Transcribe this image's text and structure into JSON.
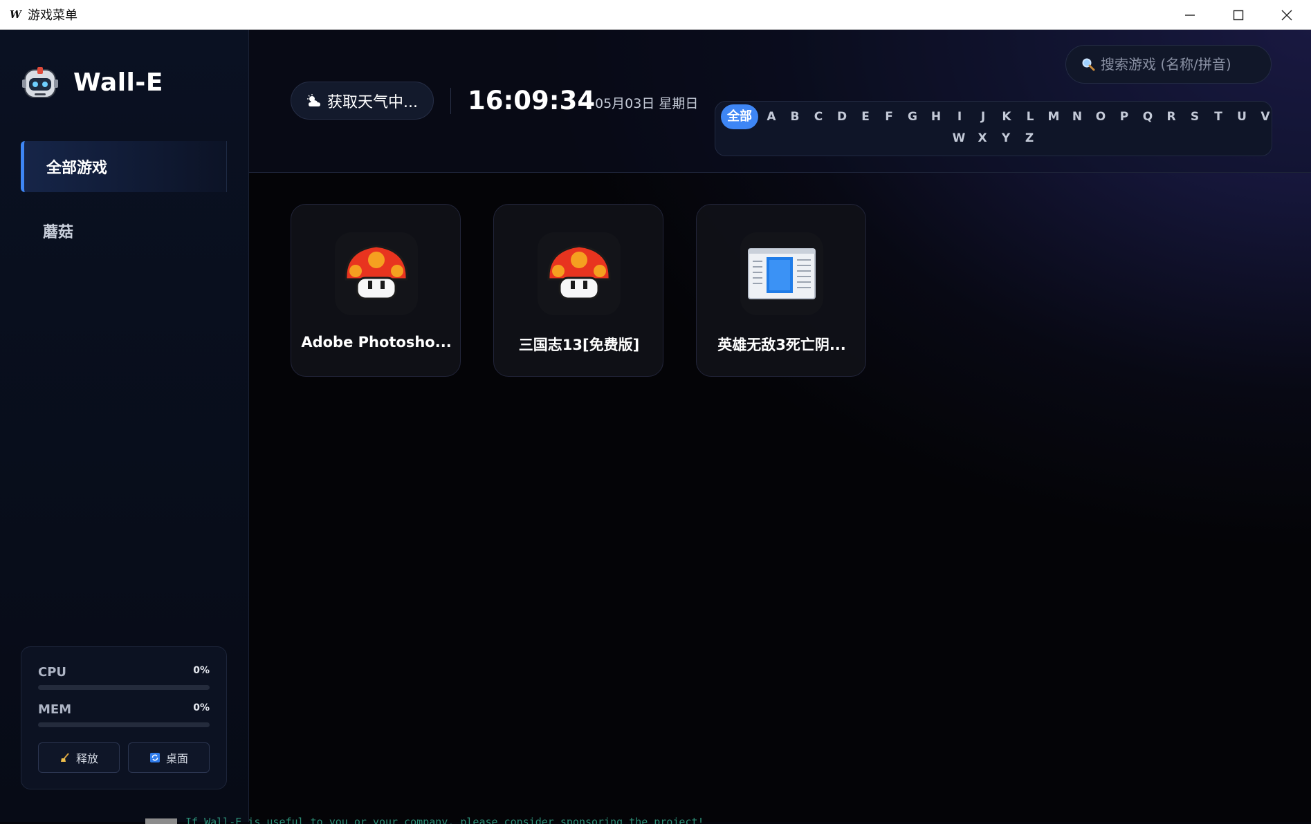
{
  "window": {
    "app_logo": "W",
    "title": "游戏菜单",
    "controls": [
      "minimize-icon",
      "maximize-icon",
      "close-icon"
    ]
  },
  "sidebar": {
    "brand": "Wall-E",
    "brand_icon": "robot-icon",
    "items": [
      {
        "label": "全部游戏",
        "active": true
      },
      {
        "label": "蘑菇",
        "active": false
      }
    ],
    "system": {
      "cpu_label": "CPU",
      "cpu_value": "0%",
      "cpu_percent": 0,
      "mem_label": "MEM",
      "mem_value": "0%",
      "mem_percent": 0,
      "release_label": "释放",
      "release_icon": "broom-icon",
      "desktop_label": "桌面",
      "desktop_icon": "refresh-icon"
    }
  },
  "header": {
    "weather": "获取天气中...",
    "weather_icon": "cloud-sun-icon",
    "time": "16:09:34",
    "date": "05月03日 星期日",
    "search_placeholder": "搜索游戏 (名称/拼音)",
    "search_icon": "search-icon",
    "alphabet": [
      "全部",
      "A",
      "B",
      "C",
      "D",
      "E",
      "F",
      "G",
      "H",
      "I",
      "J",
      "K",
      "L",
      "M",
      "N",
      "O",
      "P",
      "Q",
      "R",
      "S",
      "T",
      "U",
      "V",
      "W",
      "X",
      "Y",
      "Z"
    ],
    "active_letter": "全部"
  },
  "games": [
    {
      "title": "Adobe Photosho...",
      "icon": "mushroom-icon"
    },
    {
      "title": "三国志13[免费版]",
      "icon": "mushroom-icon"
    },
    {
      "title": "英雄无敌3死亡阴...",
      "icon": "window-app-icon"
    }
  ],
  "console_text": "If Wall-E is useful to you or your company, please consider sponsoring the project!",
  "colors": {
    "accent": "#3e86f5",
    "sidebar_bg": "#0a1122",
    "card_bg": "#101118"
  }
}
